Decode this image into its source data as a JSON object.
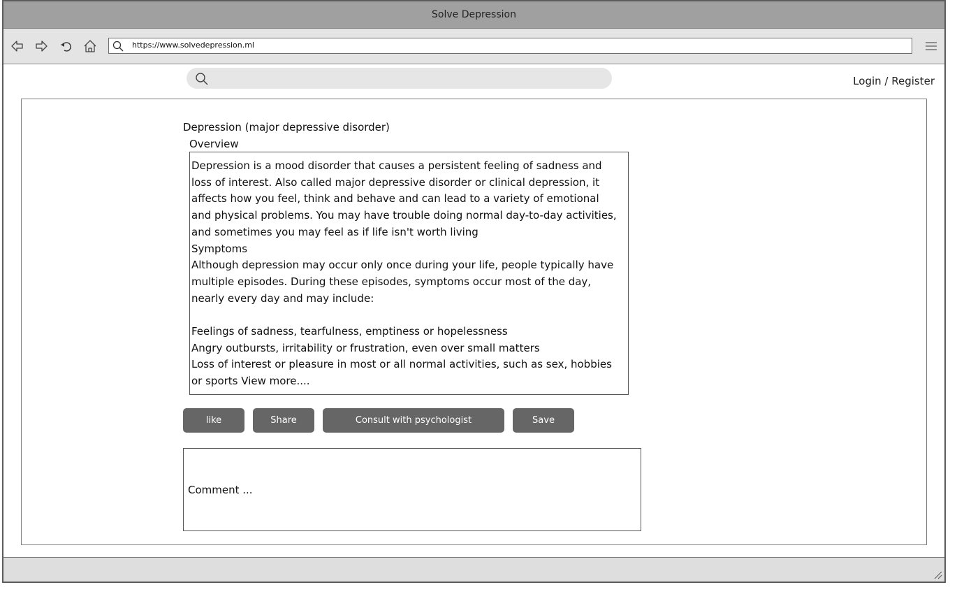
{
  "window": {
    "title": "Solve Depression"
  },
  "browser": {
    "url": "https://www.solvedepression.ml"
  },
  "search": {
    "placeholder": ""
  },
  "auth": {
    "login_label": "Login / Register"
  },
  "article": {
    "title": "Depression (major depressive disorder)",
    "section_label": "Overview",
    "lines": [
      "Depression is a mood disorder that causes a persistent feeling of sadness and",
      "loss of interest. Also called major depressive disorder or clinical depression, it",
      "affects how you feel, think and behave and can lead to a variety of emotional",
      "and physical problems. You may have trouble doing normal day-to-day activities,",
      "and sometimes you may feel as if life isn't worth living",
      "Symptoms",
      "Although depression may occur only once during your life, people typically have",
      "multiple episodes. During these episodes, symptoms occur most of the day,",
      "nearly every day and may include:",
      "",
      "Feelings of sadness, tearfulness, emptiness or hopelessness",
      "Angry outbursts, irritability or frustration, even over small matters",
      "Loss of interest or pleasure in most or all normal activities, such as sex, hobbies",
      "or sports View more...."
    ]
  },
  "actions": {
    "like": "like",
    "share": "Share",
    "consult": "Consult with psychologist",
    "save": "Save"
  },
  "comment": {
    "placeholder": "Comment ..."
  },
  "colors": {
    "button_bg": "#666666",
    "titlebar_bg": "#a0a0a0",
    "navbar_bg": "#e4e4e4"
  }
}
